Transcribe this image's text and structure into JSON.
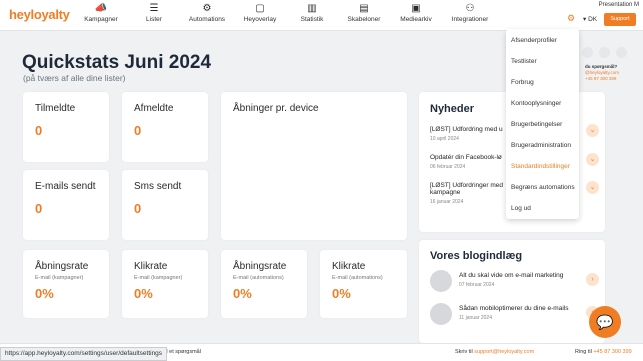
{
  "brand": {
    "logo": "heyloyalty",
    "accent": "#f07d23"
  },
  "nav": {
    "items": [
      {
        "label": "Kampagner",
        "icon": "megaphone-icon",
        "glyph": "📣"
      },
      {
        "label": "Lister",
        "icon": "list-icon",
        "glyph": "☰"
      },
      {
        "label": "Automations",
        "icon": "automation-icon",
        "glyph": "⚙"
      },
      {
        "label": "Heyoverlay",
        "icon": "overlay-icon",
        "glyph": "▢"
      },
      {
        "label": "Statistik",
        "icon": "chart-icon",
        "glyph": "▥"
      },
      {
        "label": "Skabeloner",
        "icon": "template-icon",
        "glyph": "▤"
      },
      {
        "label": "Mediearkiv",
        "icon": "image-icon",
        "glyph": "▣"
      },
      {
        "label": "Integrationer",
        "icon": "plug-icon",
        "glyph": "⚇"
      }
    ],
    "presentation": "Presentation M",
    "language": "▾ DK",
    "support": "Support"
  },
  "page": {
    "title": "Quickstats Juni 2024",
    "subtitle": "(på tværs af alle dine lister)"
  },
  "stats": {
    "tilmeldte": {
      "label": "Tilmeldte",
      "value": "0"
    },
    "afmeldte": {
      "label": "Afmeldte",
      "value": "0"
    },
    "abninger_device": {
      "label": "Åbninger pr. device"
    },
    "emails_sendt": {
      "label": "E-mails sendt",
      "value": "0"
    },
    "sms_sendt": {
      "label": "Sms sendt",
      "value": "0"
    },
    "abningsrate_k": {
      "label": "Åbningsrate",
      "sub": "E-mail (kampagner)",
      "value": "0%"
    },
    "klikrate_k": {
      "label": "Klikrate",
      "sub": "E-mail (kampagner)",
      "value": "0%"
    },
    "abningsrate_a": {
      "label": "Åbningsrate",
      "sub": "E-mail (automations)",
      "value": "0%"
    },
    "klikrate_a": {
      "label": "Klikrate",
      "sub": "E-mail (automations)",
      "value": "0%"
    }
  },
  "news": {
    "title": "Nyheder",
    "items": [
      {
        "text": "[LØST] Udfordring med u",
        "date": "10 april 2024"
      },
      {
        "text": "Opdatér din Facebook-lø",
        "date": "06 februar 2024"
      },
      {
        "text": "[LØST] Udfordringer med kampagne",
        "date": "16 januar 2024"
      }
    ]
  },
  "blog": {
    "title": "Vores blogindlæg",
    "items": [
      {
        "text": "Alt du skal vide om e-mail marketing",
        "date": "07 februar 2024"
      },
      {
        "text": "Sådan mobiloptimerer du dine e-mails",
        "date": "11 januar 2024"
      }
    ]
  },
  "dropdown": {
    "items": [
      "Afsenderprofiler",
      "Testlister",
      "Forbrug",
      "Kontooplysninger",
      "Brugerbetingelser",
      "Brugeradministration",
      "Standardindstillinger",
      "Begræns automations",
      "Log ud"
    ],
    "active_index": 6
  },
  "help": {
    "question": "du spørgsmål?",
    "email": "@heyloyalty.com",
    "phone": "+45 87 300 399"
  },
  "footer": {
    "question": "Stil et spørgsmål",
    "write_label": "Skriv til",
    "write_email": "support@heyloyalty.com",
    "ring_label": "Ring til",
    "ring_phone": "+45 87 300 399"
  },
  "status_url": "https://app.heyloyalty.com/settings/user/defaultsettings"
}
